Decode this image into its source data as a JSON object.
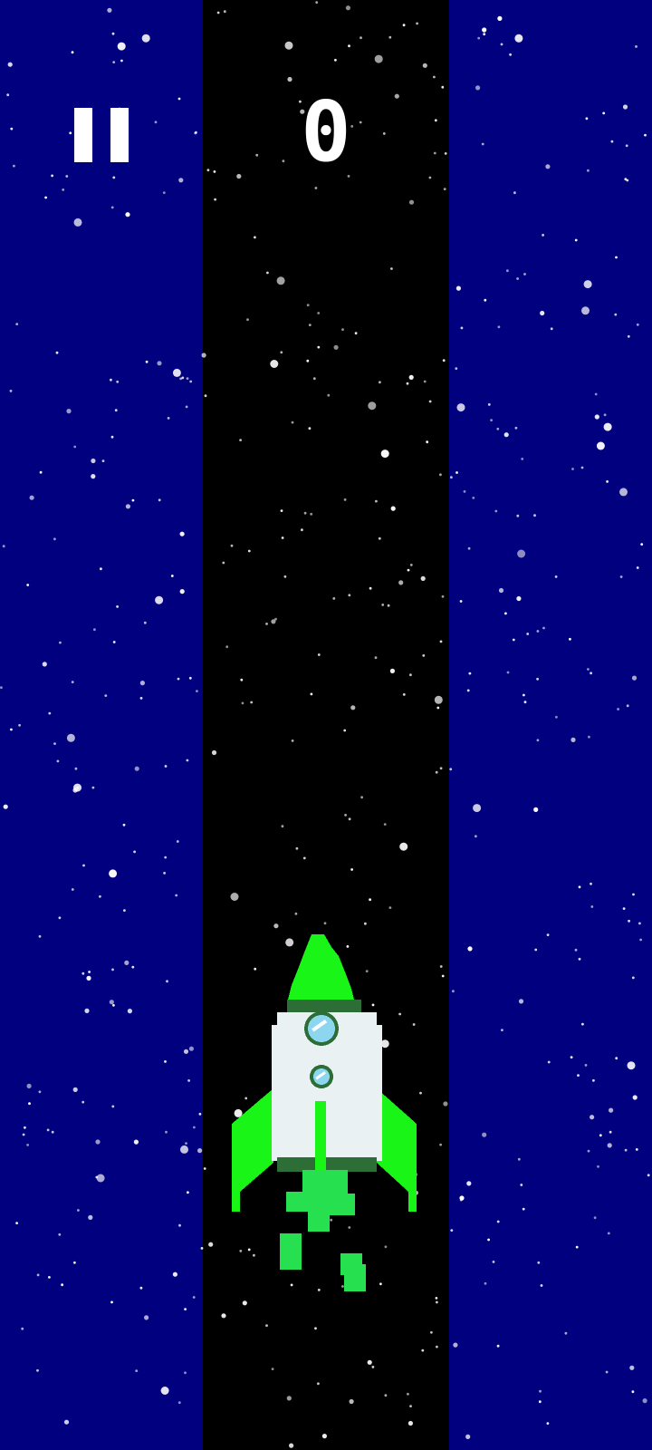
{
  "hud": {
    "pause_icon": "pause-icon",
    "score": "0"
  },
  "player": {
    "icon": "rocket-icon"
  },
  "colors": {
    "side_panel": "#01007f",
    "track": "#000000",
    "star": "#ffffff",
    "rocket_body": "#e9f1f2",
    "rocket_accent": "#19f517",
    "rocket_band": "#2d6e37",
    "window": "#8cd6ef",
    "exhaust": "#26e050",
    "hud": "#ffffff"
  }
}
